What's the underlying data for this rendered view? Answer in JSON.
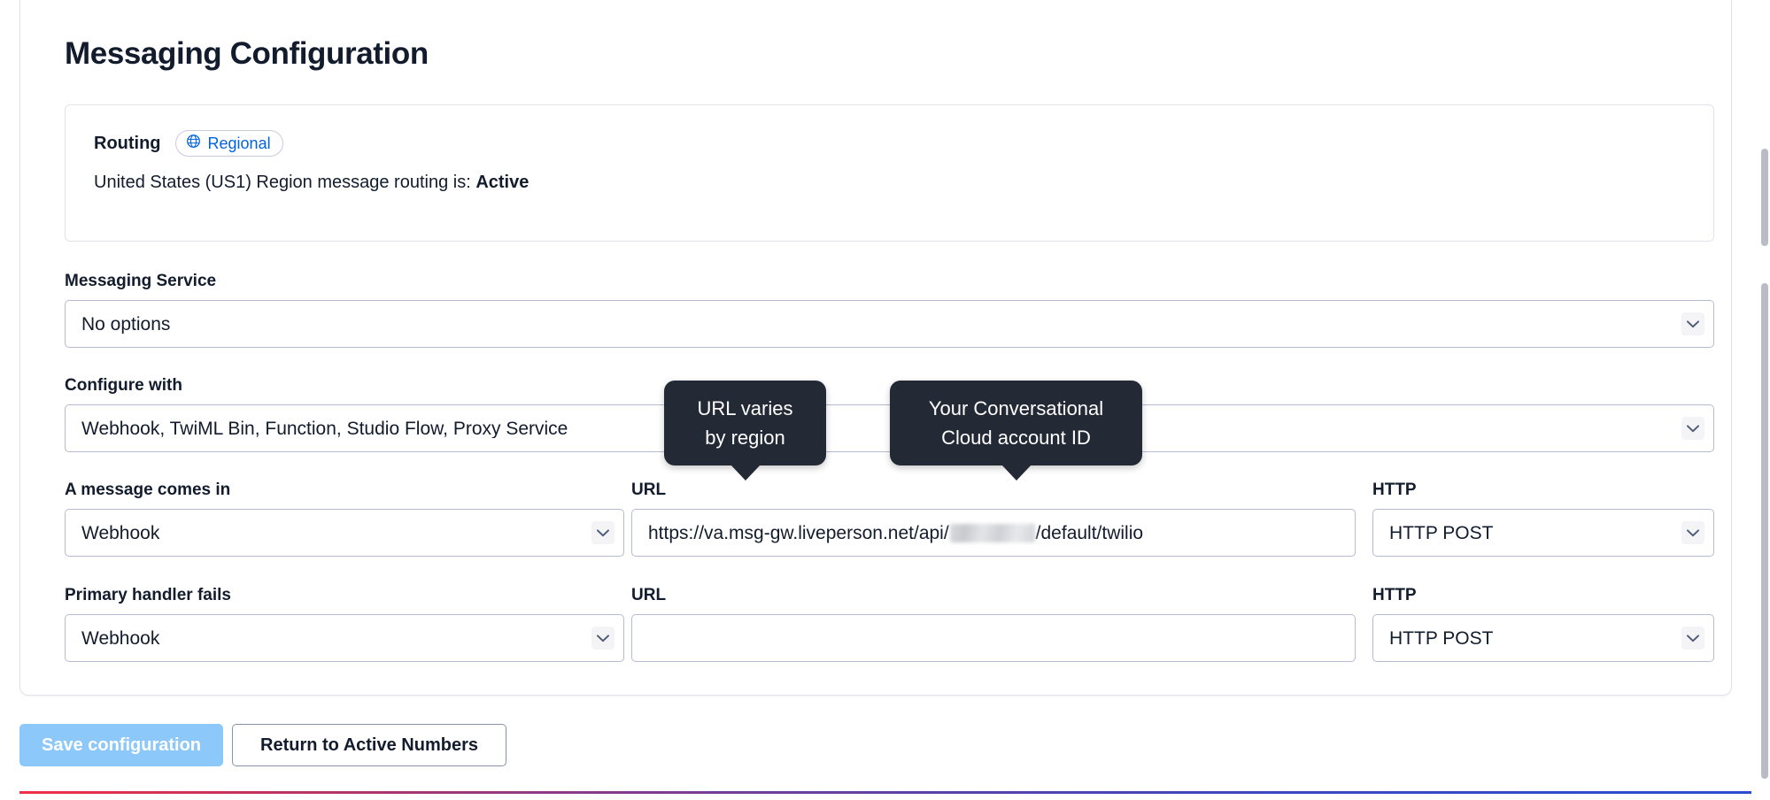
{
  "page": {
    "title": "Messaging Configuration"
  },
  "routing": {
    "label": "Routing",
    "badge_label": "Regional",
    "badge_icon": "globe-icon",
    "badge_color": "#0263e0",
    "status_prefix": "United States (US1) Region message routing is: ",
    "status_value": "Active"
  },
  "fields": {
    "messaging_service": {
      "label": "Messaging Service",
      "value": "No options",
      "placeholder": "No options"
    },
    "configure_with": {
      "label": "Configure with",
      "value": "Webhook, TwiML Bin, Function, Studio Flow, Proxy Service"
    },
    "message_comes_in": {
      "label": "A message comes in",
      "value": "Webhook",
      "url_label": "URL",
      "url_value_prefix": "https://va.msg-gw.liveperson.net/api/",
      "url_value_suffix": "/default/twilio",
      "url_redacted": true,
      "http_label": "HTTP",
      "http_value": "HTTP POST"
    },
    "primary_handler_fails": {
      "label": "Primary handler fails",
      "value": "Webhook",
      "url_label": "URL",
      "url_value": "",
      "url_placeholder": "",
      "http_label": "HTTP",
      "http_value": "HTTP POST"
    }
  },
  "tooltips": [
    {
      "name": "url-region-tooltip",
      "line1": "URL varies",
      "line2": "by region"
    },
    {
      "name": "account-id-tooltip",
      "line1": "Your Conversational",
      "line2": "Cloud account ID"
    }
  ],
  "footer": {
    "save_label": "Save configuration",
    "save_disabled": true,
    "return_label": "Return to Active Numbers"
  },
  "colors": {
    "accent_blue": "#0263e0",
    "primary_disabled": "#8cc8fa",
    "tooltip_bg": "#242a35",
    "text": "#121c2d",
    "border": "#b6bad2"
  }
}
